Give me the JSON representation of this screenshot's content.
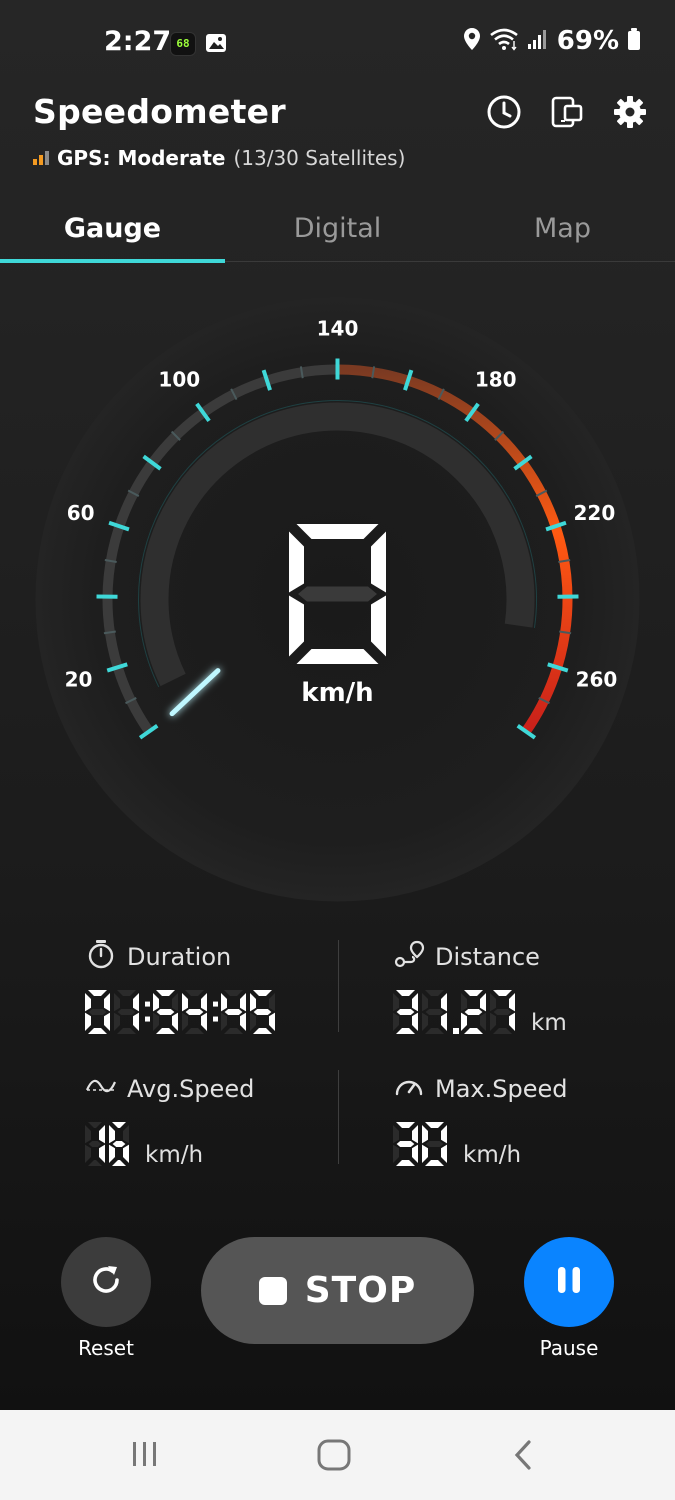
{
  "status_bar": {
    "time": "2:27",
    "speed_chip": "68",
    "battery": "69%",
    "icons": [
      "speedometer-app-icon",
      "gallery-icon",
      "location-icon",
      "wifi-icon",
      "signal-icon",
      "battery-icon"
    ]
  },
  "header": {
    "title": "Speedometer",
    "gps_label": "GPS: Moderate",
    "gps_satellites": "(13/30 Satellites)",
    "gps_color": "#f39a22",
    "icons": [
      "history-clock-icon",
      "floating-window-icon",
      "settings-gear-icon"
    ]
  },
  "tabs": [
    {
      "label": "Gauge",
      "active": true
    },
    {
      "label": "Digital",
      "active": false
    },
    {
      "label": "Map",
      "active": false
    }
  ],
  "gauge": {
    "speed": "0",
    "unit": "km/h",
    "min": 0,
    "max": 280,
    "tick_labels": [
      "20",
      "60",
      "100",
      "140",
      "180",
      "220",
      "260"
    ],
    "accent": "#3fd8d8"
  },
  "stats": {
    "duration": {
      "label": "Duration",
      "value": "01:54:45",
      "unit": ""
    },
    "distance": {
      "label": "Distance",
      "value": "31.27",
      "unit": "km"
    },
    "avg_speed": {
      "label": "Avg.Speed",
      "value": "16",
      "unit": "km/h"
    },
    "max_speed": {
      "label": "Max.Speed",
      "value": "30",
      "unit": "km/h"
    }
  },
  "controls": {
    "reset_label": "Reset",
    "stop_label": "STOP",
    "pause_label": "Pause",
    "pause_color": "#0a84ff"
  },
  "navbar": {
    "icons": [
      "recent-apps-icon",
      "home-icon",
      "back-icon"
    ]
  }
}
